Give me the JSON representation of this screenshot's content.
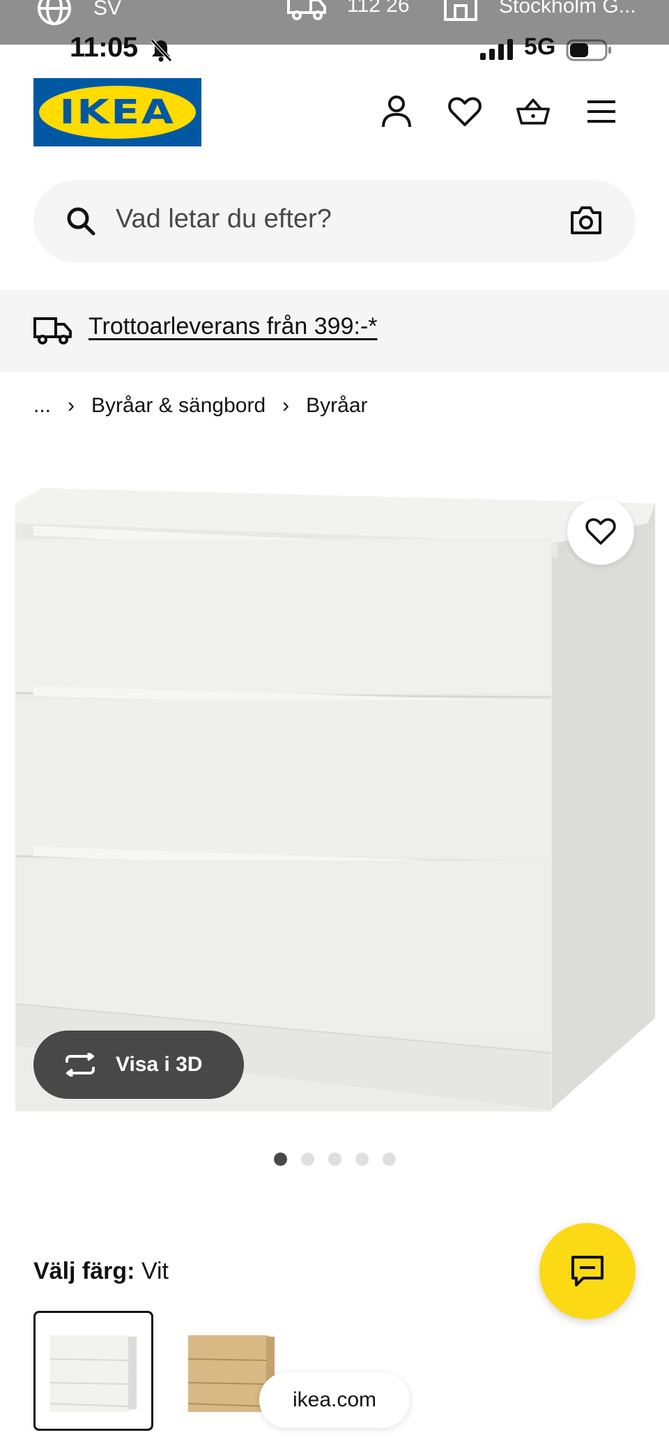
{
  "browser_strip": {
    "language": "SV",
    "postcode": "112 26",
    "store": "Stockholm G..."
  },
  "status_bar": {
    "time": "11:05",
    "network": "5G"
  },
  "header": {
    "logo_text": "IKEA"
  },
  "search": {
    "placeholder": "Vad letar du efter?"
  },
  "delivery_banner": {
    "text": "Trottoarleverans från 399:-*"
  },
  "breadcrumb": {
    "items": [
      "...",
      "Byråar & sängbord",
      "Byråar"
    ]
  },
  "product_image": {
    "view_3d_label": "Visa i 3D",
    "gallery": {
      "count": 5,
      "active_index": 0
    }
  },
  "color_choice": {
    "label": "Välj färg:",
    "value": "Vit",
    "options": [
      {
        "name": "white",
        "color": "#f2f2f0",
        "selected": true
      },
      {
        "name": "oak",
        "color": "#d8b885",
        "selected": false
      }
    ]
  },
  "browser_url": "ikea.com",
  "colors": {
    "brand_blue": "#0058a3",
    "brand_yellow": "#ffdb00",
    "chat_yellow": "#fbd914"
  }
}
